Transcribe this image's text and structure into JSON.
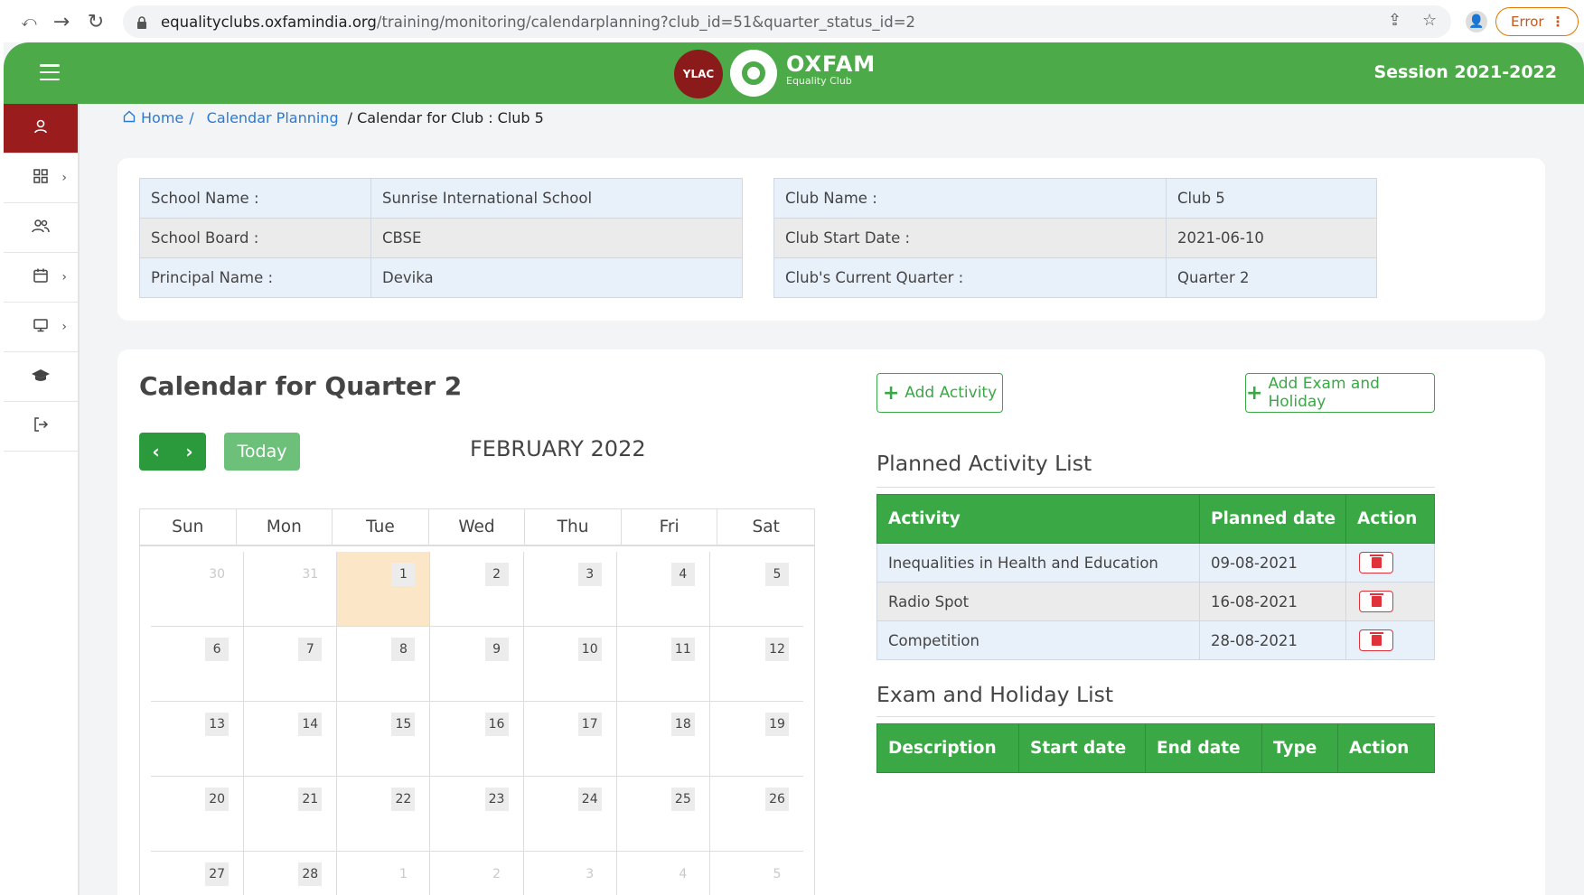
{
  "browser": {
    "url_host": "equalityclubs.oxfamindia.org",
    "url_path": "/training/monitoring/calendarplanning?club_id=51&quarter_status_id=2",
    "error_label": "Error"
  },
  "header": {
    "ylac_logo": "YLAC",
    "brand_name": "OXFAM",
    "brand_sub": "Equality Club",
    "session": "Session 2021-2022",
    "color": "#4caa48"
  },
  "sidebar": {
    "items": [
      {
        "icon": "user-icon",
        "active": true
      },
      {
        "icon": "grid-icon",
        "chevron": true
      },
      {
        "icon": "users-icon"
      },
      {
        "icon": "calendar-icon",
        "chevron": true
      },
      {
        "icon": "monitor-icon",
        "chevron": true
      },
      {
        "icon": "graduation-cap-icon"
      },
      {
        "icon": "logout-icon"
      }
    ]
  },
  "breadcrumb": {
    "home": "Home",
    "sep1": "/",
    "calendar_planning": "Calendar Planning",
    "current": "/ Calendar for Club : Club 5"
  },
  "school_info": {
    "rows": [
      {
        "label": "School Name :",
        "value": "Sunrise International School"
      },
      {
        "label": "School Board :",
        "value": "CBSE"
      },
      {
        "label": "Principal Name :",
        "value": "Devika"
      }
    ]
  },
  "club_info": {
    "rows": [
      {
        "label": "Club Name :",
        "value": "Club 5"
      },
      {
        "label": "Club Start Date :",
        "value": "2021-06-10"
      },
      {
        "label": "Club's Current Quarter :",
        "value": "Quarter 2"
      }
    ]
  },
  "calendar": {
    "title": "Calendar for Quarter 2",
    "prev": "‹",
    "next": "›",
    "today_label": "Today",
    "month": "FEBRUARY 2022",
    "weekdays": [
      "Sun",
      "Mon",
      "Tue",
      "Wed",
      "Thu",
      "Fri",
      "Sat"
    ],
    "today_day": "1",
    "weeks": [
      [
        {
          "d": "30",
          "o": true
        },
        {
          "d": "31",
          "o": true
        },
        {
          "d": "1"
        },
        {
          "d": "2"
        },
        {
          "d": "3"
        },
        {
          "d": "4"
        },
        {
          "d": "5"
        }
      ],
      [
        {
          "d": "6"
        },
        {
          "d": "7"
        },
        {
          "d": "8"
        },
        {
          "d": "9"
        },
        {
          "d": "10"
        },
        {
          "d": "11"
        },
        {
          "d": "12"
        }
      ],
      [
        {
          "d": "13"
        },
        {
          "d": "14"
        },
        {
          "d": "15"
        },
        {
          "d": "16"
        },
        {
          "d": "17"
        },
        {
          "d": "18"
        },
        {
          "d": "19"
        }
      ],
      [
        {
          "d": "20"
        },
        {
          "d": "21"
        },
        {
          "d": "22"
        },
        {
          "d": "23"
        },
        {
          "d": "24"
        },
        {
          "d": "25"
        },
        {
          "d": "26"
        }
      ],
      [
        {
          "d": "27"
        },
        {
          "d": "28"
        },
        {
          "d": "1",
          "o": true
        },
        {
          "d": "2",
          "o": true
        },
        {
          "d": "3",
          "o": true
        },
        {
          "d": "4",
          "o": true
        },
        {
          "d": "5",
          "o": true
        }
      ]
    ]
  },
  "actions": {
    "add_activity": "Add Activity",
    "add_exam": "Add Exam and Holiday"
  },
  "planned": {
    "title": "Planned Activity List",
    "headers": [
      "Activity",
      "Planned date",
      "Action"
    ],
    "rows": [
      {
        "activity": "Inequalities in Health and Education",
        "date": "09-08-2021"
      },
      {
        "activity": "Radio Spot",
        "date": "16-08-2021"
      },
      {
        "activity": "Competition",
        "date": "28-08-2021"
      }
    ]
  },
  "exam": {
    "title": "Exam and Holiday List",
    "headers": [
      "Description",
      "Start date",
      "End date",
      "Type",
      "Action"
    ]
  }
}
